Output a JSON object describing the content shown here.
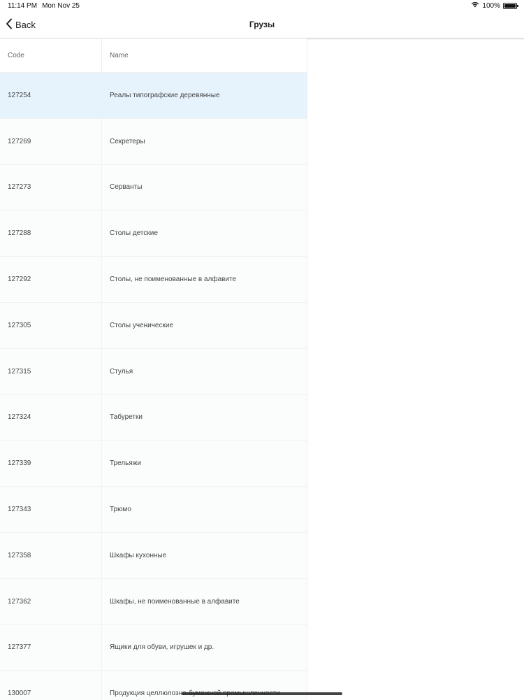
{
  "status_bar": {
    "time": "11:14 PM",
    "date": "Mon Nov 25",
    "battery": "100%",
    "battery_level": 1.0
  },
  "nav": {
    "back_label": "Back",
    "title": "Грузы"
  },
  "table": {
    "columns": [
      "Code",
      "Name"
    ],
    "rows": [
      {
        "code": "127254",
        "name": "Реалы типографские деревянные",
        "selected": true
      },
      {
        "code": "127269",
        "name": "Секретеры",
        "selected": false
      },
      {
        "code": "127273",
        "name": "Серванты",
        "selected": false
      },
      {
        "code": "127288",
        "name": "Столы детские",
        "selected": false
      },
      {
        "code": "127292",
        "name": "Столы, не поименованные в алфавите",
        "selected": false
      },
      {
        "code": "127305",
        "name": "Столы ученические",
        "selected": false
      },
      {
        "code": "127315",
        "name": "Стулья",
        "selected": false
      },
      {
        "code": "127324",
        "name": "Табуретки",
        "selected": false
      },
      {
        "code": "127339",
        "name": "Трельяжи",
        "selected": false
      },
      {
        "code": "127343",
        "name": "Трюмо",
        "selected": false
      },
      {
        "code": "127358",
        "name": "Шкафы кухонные",
        "selected": false
      },
      {
        "code": "127362",
        "name": "Шкафы, не поименованные в алфавите",
        "selected": false
      },
      {
        "code": "127377",
        "name": "Ящики для обуви, игрушек и др.",
        "selected": false
      },
      {
        "code": "130007",
        "name": "Продукция целлюлозно-бумажной промышленности",
        "selected": false
      }
    ]
  },
  "colors": {
    "selected_row": "#e6f3fd",
    "row_background": "#fbfdfd"
  }
}
